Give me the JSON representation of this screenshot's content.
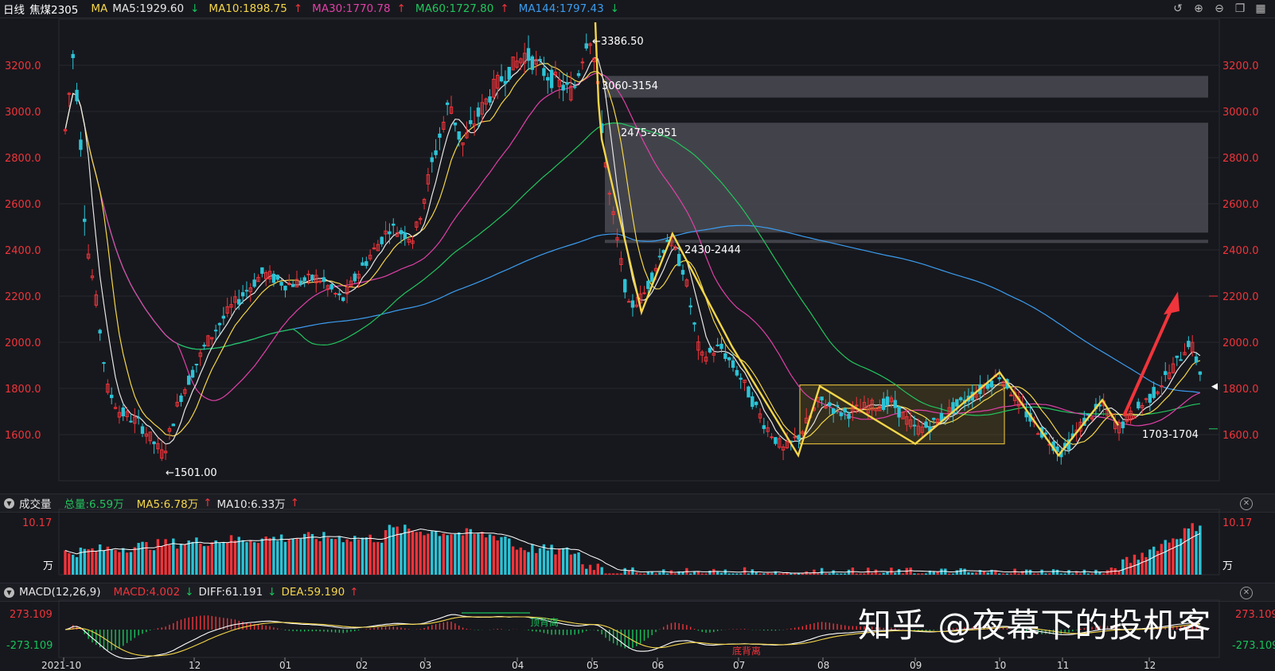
{
  "header": {
    "period": "日线",
    "symbol": "焦煤2305",
    "ma_label": "MA",
    "ma_items": [
      {
        "label": "MA5:1929.60",
        "arrow": "↓",
        "dir": "dn",
        "color": "#e6e6e6"
      },
      {
        "label": "MA10:1898.75",
        "arrow": "↑",
        "dir": "up",
        "color": "#f5d64a"
      },
      {
        "label": "MA30:1770.78",
        "arrow": "↑",
        "dir": "up",
        "color": "#e040a8"
      },
      {
        "label": "MA60:1727.80",
        "arrow": "↑",
        "dir": "up",
        "color": "#22c55e"
      },
      {
        "label": "MA144:1797.43",
        "arrow": "↓",
        "dir": "dn",
        "color": "#3b9cf0"
      }
    ]
  },
  "volume_header": {
    "title": "成交量",
    "total": "总量:6.59万",
    "ma5": "MA5:6.78万",
    "ma5_arrow": "↑",
    "ma10": "MA10:6.33万",
    "ma10_arrow": "↑"
  },
  "macd_header": {
    "title": "MACD(12,26,9)",
    "macd": "MACD:4.002",
    "macd_arrow": "↓",
    "diff": "DIFF:61.191",
    "diff_arrow": "↓",
    "dea": "DEA:59.190",
    "dea_arrow": "↑"
  },
  "watermark": "知乎 @夜幕下的投机客",
  "colors": {
    "up": "#f0343b",
    "down": "#2cc3d6",
    "ma5": "#e6e6e6",
    "ma10": "#f5d64a",
    "ma30": "#e040a8",
    "ma60": "#22c55e",
    "ma144": "#3b9cf0",
    "zone": "#4a4b52",
    "box": "#c9a227"
  },
  "chart_data": {
    "type": "candlestick",
    "price_axis": {
      "min": 1400,
      "max": 3400,
      "ticks": [
        "1600.0",
        "1800.0",
        "2000.0",
        "2200.0",
        "2400.0",
        "2600.0",
        "2800.0",
        "3000.0",
        "3200.0"
      ]
    },
    "x_ticks": [
      "2021-10",
      "12",
      "01",
      "02",
      "03",
      "04",
      "05",
      "06",
      "07",
      "08",
      "09",
      "10",
      "11",
      "12"
    ],
    "annotations": {
      "high": "←3386.50",
      "low": "←1501.00",
      "zone1": "3060-3154",
      "zone2": "2475-2951",
      "zone3": "2430-2444",
      "level": "1703-1704"
    },
    "zones": [
      {
        "label": "3060-3154",
        "from": 3060,
        "to": 3154
      },
      {
        "label": "2475-2951",
        "from": 2475,
        "to": 2951
      },
      {
        "label": "2430-2444",
        "from": 2430,
        "to": 2444
      }
    ],
    "range_box": {
      "from": 1560,
      "to": 1815
    },
    "high_value": 3386.5,
    "low_value": 1501.0,
    "volume_axis": {
      "max_label": "10.17",
      "unit": "万"
    },
    "macd_axis": {
      "top_label": "273.109",
      "bottom_label": "-273.109"
    },
    "macd_texts": {
      "top_divergence": "顶背离",
      "bottom_divergence": "底背离"
    },
    "zigzag": [
      {
        "x": "05",
        "y": 3386
      },
      {
        "x": "05",
        "y": 3040
      },
      {
        "x": "05",
        "y": 2880
      },
      {
        "x": "06",
        "y": 2130
      },
      {
        "x": "06",
        "y": 2470
      },
      {
        "x": "07",
        "y": 1980
      },
      {
        "x": "08",
        "y": 1510
      },
      {
        "x": "08",
        "y": 1810
      },
      {
        "x": "09",
        "y": 1560
      },
      {
        "x": "10",
        "y": 1870
      },
      {
        "x": "11",
        "y": 1510
      },
      {
        "x": "11",
        "y": 1750
      },
      {
        "x": "12",
        "y": 1640
      }
    ]
  }
}
